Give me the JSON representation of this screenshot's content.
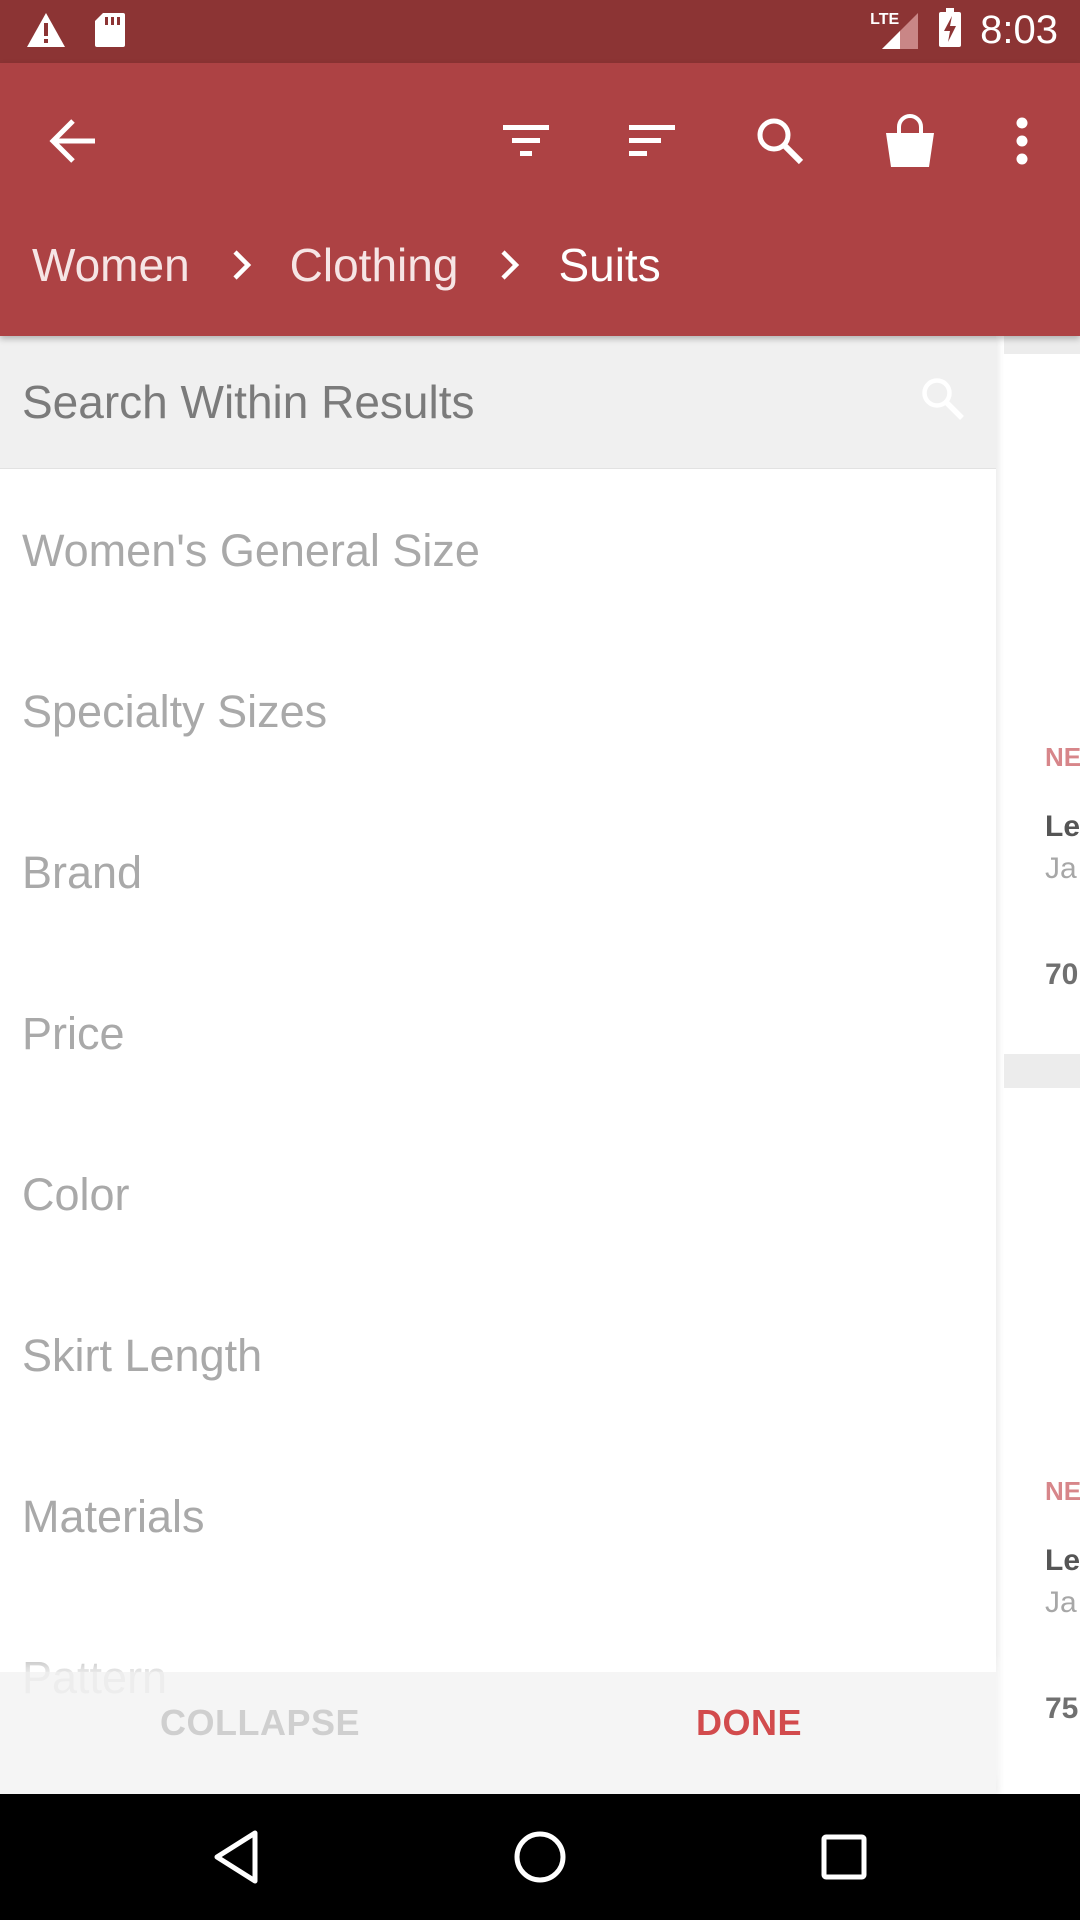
{
  "status_bar": {
    "time": "8:03",
    "network": "LTE",
    "left_icons": [
      "warning-icon",
      "sd-card-icon"
    ],
    "right_icons": [
      "lte-signal-icon",
      "battery-charging-icon"
    ]
  },
  "app_bar": {
    "background_color": "#ad4244",
    "actions": [
      "back-arrow-icon",
      "filter-icon",
      "sort-icon",
      "search-icon",
      "shopping-bag-icon",
      "more-vert-icon"
    ],
    "breadcrumb": [
      "Women",
      "Clothing",
      "Suits"
    ]
  },
  "filter_panel": {
    "search_placeholder": "Search Within Results",
    "items": [
      "Women's General Size",
      "Specialty Sizes",
      "Brand",
      "Price",
      "Color",
      "Skirt Length",
      "Materials",
      "Pattern"
    ],
    "collapse_label": "COLLAPSE",
    "done_label": "DONE",
    "accent_color": "#d24b4d"
  },
  "products_partial": [
    {
      "badge": "NEW",
      "name": "Le",
      "brand": "Ja",
      "price": "70"
    },
    {
      "badge": "NEW",
      "name": "Le",
      "brand": "Ja",
      "price": "75"
    }
  ],
  "nav_bar": {
    "buttons": [
      "back-triangle-icon",
      "home-circle-icon",
      "recents-square-icon"
    ]
  }
}
